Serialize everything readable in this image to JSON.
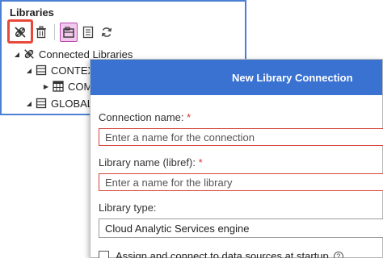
{
  "libraries_panel": {
    "title": "Libraries",
    "toolbar": {
      "disconnect_icon": "disconnect-icon",
      "delete_icon": "trash-icon",
      "new_library_icon": "new-library-icon",
      "properties_icon": "properties-icon",
      "refresh_icon": "refresh-icon"
    },
    "tree": [
      {
        "label": "Connected Libraries",
        "level": 0,
        "expanded": true,
        "icon": "disconnect-icon"
      },
      {
        "label": "CONTEX",
        "level": 1,
        "expanded": true,
        "icon": "server-icon"
      },
      {
        "label": "COM",
        "level": 2,
        "expanded": false,
        "icon": "table-icon"
      },
      {
        "label": "GLOBAL",
        "level": 1,
        "expanded": true,
        "icon": "server-icon"
      }
    ]
  },
  "dialog": {
    "title": "New Library Connection",
    "connection_name": {
      "label": "Connection name:",
      "required_mark": "*",
      "placeholder": "Enter a name for the connection",
      "value": ""
    },
    "library_name": {
      "label": "Library name (libref):",
      "required_mark": "*",
      "placeholder": "Enter a name for the library",
      "value": ""
    },
    "library_type": {
      "label": "Library type:",
      "selected": "Cloud Analytic Services engine"
    },
    "startup_checkbox": {
      "label": "Assign and connect to data sources at startup",
      "checked": false
    }
  },
  "colors": {
    "panel_border": "#4a7fd4",
    "dialog_header": "#3a72d2",
    "error_border": "#d6453b",
    "highlight": "#e8483a",
    "active_button": "#f2c8ee"
  }
}
